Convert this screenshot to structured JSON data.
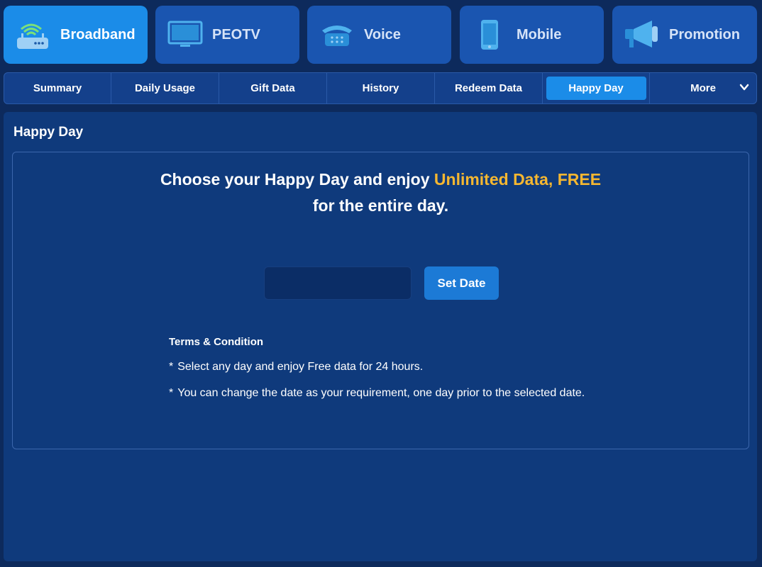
{
  "service_tabs": [
    {
      "label": "Broadband",
      "icon": "wifi-router-icon",
      "active": true
    },
    {
      "label": "PEOTV",
      "icon": "tv-icon",
      "active": false
    },
    {
      "label": "Voice",
      "icon": "telephone-icon",
      "active": false
    },
    {
      "label": "Mobile",
      "icon": "mobile-phone-icon",
      "active": false
    },
    {
      "label": "Promotion",
      "icon": "megaphone-icon",
      "active": false
    }
  ],
  "subnav": {
    "items": [
      {
        "label": "Summary"
      },
      {
        "label": "Daily Usage"
      },
      {
        "label": "Gift Data"
      },
      {
        "label": "History"
      },
      {
        "label": "Redeem Data"
      },
      {
        "label": "Happy Day",
        "active": true
      },
      {
        "label": "More"
      }
    ]
  },
  "panel": {
    "title": "Happy Day",
    "headline_part1": "Choose your Happy Day and enjoy ",
    "headline_highlight": "Unlimited Data, FREE",
    "headline_part2": "for the entire day.",
    "date_input_value": "",
    "set_date_label": "Set Date",
    "terms_title": "Terms & Condition",
    "terms": [
      "Select any day and enjoy Free data for 24 hours.",
      "You can change the date as your requirement, one day prior to the selected date."
    ],
    "term_bullet": "*"
  },
  "colors": {
    "background": "#0d2a5c",
    "tab": "#1a55b0",
    "tab_active": "#1b8ce8",
    "highlight": "#f5b731",
    "button": "#1c7ad6"
  }
}
